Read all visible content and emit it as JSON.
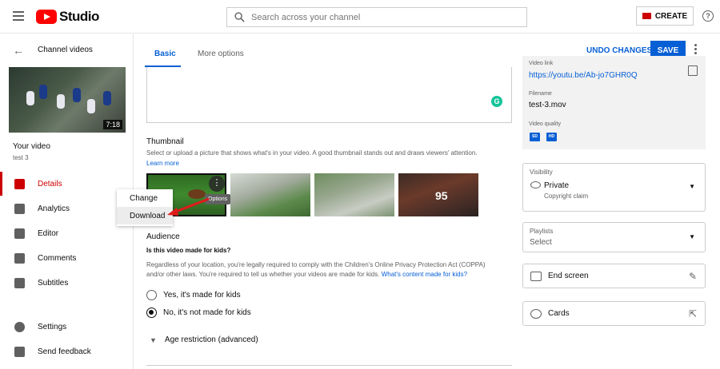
{
  "topbar": {
    "brand": "Studio",
    "search_placeholder": "Search across your channel",
    "create_label": "CREATE",
    "help_glyph": "?"
  },
  "sidebar": {
    "back_label": "Channel videos",
    "video_duration": "7:18",
    "your_video": "Your video",
    "video_name": "test 3",
    "items": [
      {
        "label": "Details",
        "icon": "pencil-icon",
        "active": true
      },
      {
        "label": "Analytics",
        "icon": "bar-chart-icon"
      },
      {
        "label": "Editor",
        "icon": "film-icon"
      },
      {
        "label": "Comments",
        "icon": "comment-icon"
      },
      {
        "label": "Subtitles",
        "icon": "subtitles-icon"
      },
      {
        "label": "Settings",
        "icon": "gear-icon"
      },
      {
        "label": "Send feedback",
        "icon": "feedback-icon"
      }
    ]
  },
  "tabs": [
    {
      "label": "Basic",
      "active": true
    },
    {
      "label": "More options"
    }
  ],
  "header_actions": {
    "undo_label": "UNDO CHANGES",
    "save_label": "SAVE"
  },
  "thumbnail": {
    "title": "Thumbnail",
    "description": "Select or upload a picture that shows what's in your video. A good thumbnail stands out and draws viewers' attention.",
    "learn_more": "Learn more",
    "options_tooltip": "Options",
    "menu": [
      "Change",
      "Download"
    ],
    "frame_number": "95"
  },
  "audience": {
    "title": "Audience",
    "question": "Is this video made for kids?",
    "body": "Regardless of your location, you're legally required to comply with the Children's Online Privacy Protection Act (COPPA) and/or other laws. You're required to tell us whether your videos are made for kids.",
    "link": "What's content made for kids?",
    "options": [
      "Yes, it's made for kids",
      "No, it's not made for kids"
    ],
    "selected": 1,
    "age_restriction": "Age restriction (advanced)"
  },
  "video_info": {
    "link_label": "Video link",
    "link": "https://youtu.be/Ab-jo7GHR0Q",
    "filename_label": "Filename",
    "filename": "test-3.mov",
    "quality_label": "Video quality",
    "quality_badges": [
      "SD",
      "HD"
    ]
  },
  "visibility": {
    "label": "Visibility",
    "value": "Private",
    "sub": "Copyright claim"
  },
  "playlists": {
    "label": "Playlists",
    "value": "Select"
  },
  "end_screen": "End screen",
  "cards": "Cards",
  "colors": {
    "accent": "#065fd4",
    "brand_red": "#ff0000",
    "active_red": "#cc0000"
  }
}
